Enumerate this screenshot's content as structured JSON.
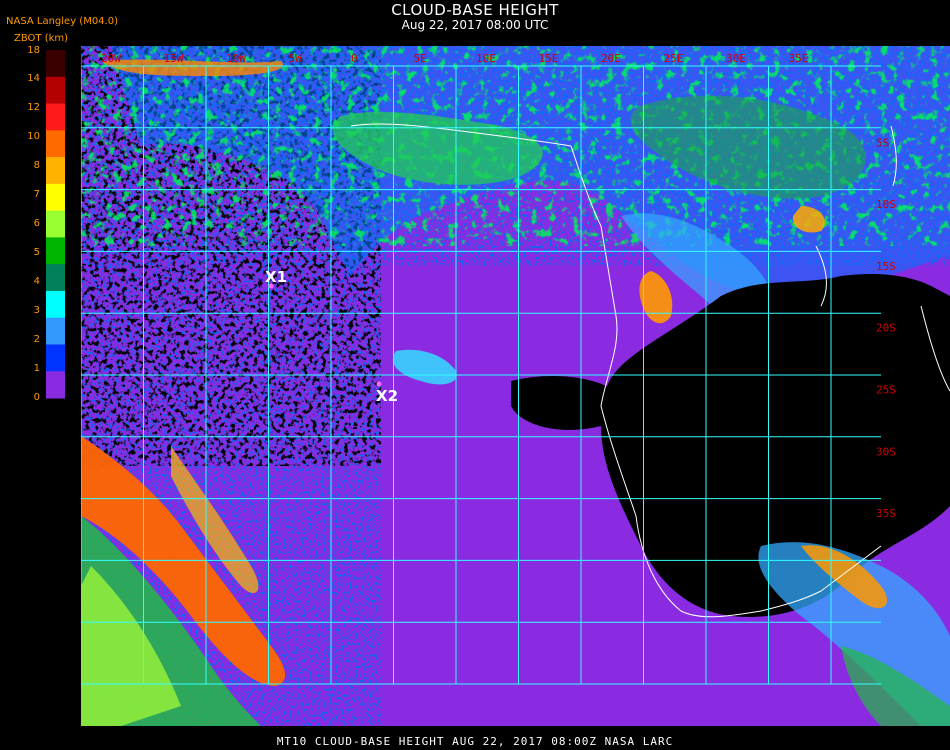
{
  "header": {
    "title": "CLOUD-BASE HEIGHT",
    "subtitle": "Aug 22, 2017 08:00 UTC",
    "org": "NASA Langley (M04.0)",
    "unit": "ZBOT (km)"
  },
  "legend": {
    "labels": [
      "18",
      "14",
      "12",
      "10",
      "8",
      "7",
      "6",
      "5",
      "4",
      "3",
      "2",
      "1",
      "0"
    ],
    "colors": [
      "#3a0000",
      "#b30000",
      "#ff1a1a",
      "#ff6a00",
      "#ffb300",
      "#ffff00",
      "#99ff33",
      "#00b300",
      "#00805a",
      "#00ffff",
      "#3399ff",
      "#0033ff",
      "#8a2be2"
    ]
  },
  "map": {
    "lat_labels": [
      "5S",
      "10S",
      "15S",
      "20S",
      "25S",
      "30S",
      "35S"
    ],
    "lon_labels": [
      "20W",
      "15W",
      "10W",
      "5W",
      "0",
      "5E",
      "10E",
      "15E",
      "20E",
      "25E",
      "30E",
      "35E"
    ],
    "markers": [
      {
        "label": "X1"
      },
      {
        "label": "X2"
      }
    ],
    "colors": {
      "background": "#8a2be2",
      "clear": "#000000",
      "grid": "#33ffff",
      "coast": "#ffffff",
      "latlon_text": "#cc0000"
    }
  },
  "footer": "MT10  CLOUD-BASE HEIGHT   AUG 22, 2017 08:00Z   NASA LARC"
}
